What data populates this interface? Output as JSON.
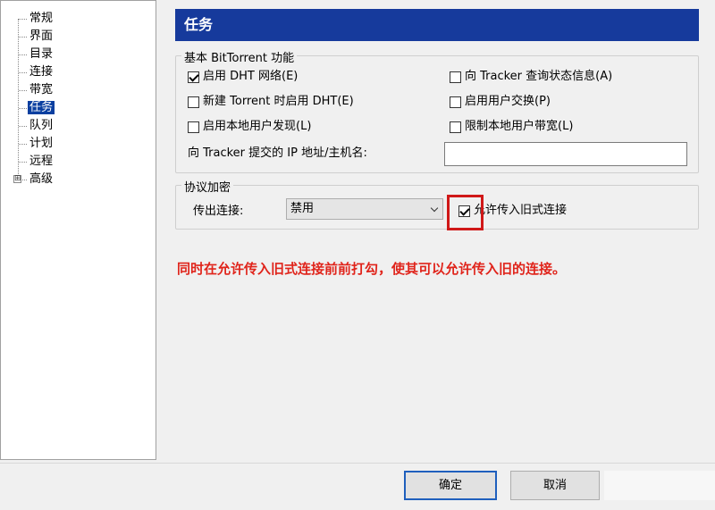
{
  "tree": {
    "items": [
      {
        "label": "常规"
      },
      {
        "label": "界面"
      },
      {
        "label": "目录"
      },
      {
        "label": "连接"
      },
      {
        "label": "带宽"
      },
      {
        "label": "任务"
      },
      {
        "label": "队列"
      },
      {
        "label": "计划"
      },
      {
        "label": "远程"
      },
      {
        "label": "高级",
        "expander": "⊞"
      }
    ],
    "selected_index": 5
  },
  "header": {
    "title": "任务"
  },
  "bt_group": {
    "title": "基本 BitTorrent 功能",
    "options": [
      {
        "label": "启用 DHT 网络(E)",
        "checked": true
      },
      {
        "label": "向 Tracker 查询状态信息(A)",
        "checked": false
      },
      {
        "label": "新建 Torrent 时启用 DHT(E)",
        "checked": false
      },
      {
        "label": "启用用户交换(P)",
        "checked": false
      },
      {
        "label": "启用本地用户发现(L)",
        "checked": false
      },
      {
        "label": "限制本地用户带宽(L)",
        "checked": false
      }
    ],
    "ip_label": "向 Tracker 提交的 IP 地址/主机名:",
    "ip_value": ""
  },
  "enc_group": {
    "title": "协议加密",
    "outgoing_label": "传出连接:",
    "outgoing_value": "禁用",
    "legacy_label": "允许传入旧式连接",
    "legacy_checked": true
  },
  "annotation": "同时在允许传入旧式连接前前打勾，使其可以允许传入旧的连接。",
  "buttons": {
    "ok": "确定",
    "cancel": "取消"
  },
  "colors": {
    "header_bg": "#163a9c",
    "selected_bg": "#0a3fa0",
    "annotation": "#e0241b",
    "highlight": "#d01818"
  }
}
